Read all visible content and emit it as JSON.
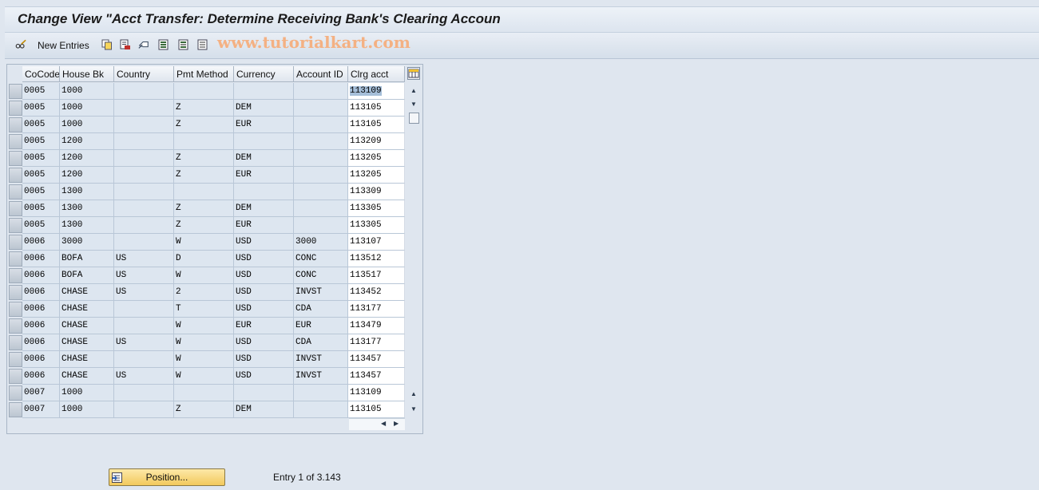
{
  "window": {
    "title": "Change View \"Acct Transfer: Determine Receiving Bank's Clearing Accoun"
  },
  "toolbar": {
    "new_entries_label": "New Entries",
    "icons": [
      "glasses-pencil-icon",
      "copy-icon",
      "delete-icon",
      "undo-icon",
      "select-all-icon",
      "select-block-icon",
      "deselect-all-icon"
    ],
    "watermark": "www.tutorialkart.com"
  },
  "table": {
    "columns": [
      "CoCode",
      "House Bk",
      "Country",
      "Pmt Method",
      "Currency",
      "Account ID",
      "Clrg acct"
    ],
    "rows": [
      [
        "0005",
        "1000",
        "",
        "",
        "",
        "",
        "113109"
      ],
      [
        "0005",
        "1000",
        "",
        "Z",
        "DEM",
        "",
        "113105"
      ],
      [
        "0005",
        "1000",
        "",
        "Z",
        "EUR",
        "",
        "113105"
      ],
      [
        "0005",
        "1200",
        "",
        "",
        "",
        "",
        "113209"
      ],
      [
        "0005",
        "1200",
        "",
        "Z",
        "DEM",
        "",
        "113205"
      ],
      [
        "0005",
        "1200",
        "",
        "Z",
        "EUR",
        "",
        "113205"
      ],
      [
        "0005",
        "1300",
        "",
        "",
        "",
        "",
        "113309"
      ],
      [
        "0005",
        "1300",
        "",
        "Z",
        "DEM",
        "",
        "113305"
      ],
      [
        "0005",
        "1300",
        "",
        "Z",
        "EUR",
        "",
        "113305"
      ],
      [
        "0006",
        "3000",
        "",
        "W",
        "USD",
        "3000",
        "113107"
      ],
      [
        "0006",
        "BOFA",
        "US",
        "D",
        "USD",
        "CONC",
        "113512"
      ],
      [
        "0006",
        "BOFA",
        "US",
        "W",
        "USD",
        "CONC",
        "113517"
      ],
      [
        "0006",
        "CHASE",
        "US",
        "2",
        "USD",
        "INVST",
        "113452"
      ],
      [
        "0006",
        "CHASE",
        "",
        "T",
        "USD",
        "CDA",
        "113177"
      ],
      [
        "0006",
        "CHASE",
        "",
        "W",
        "EUR",
        "EUR",
        "113479"
      ],
      [
        "0006",
        "CHASE",
        "US",
        "W",
        "USD",
        "CDA",
        "113177"
      ],
      [
        "0006",
        "CHASE",
        "",
        "W",
        "USD",
        "INVST",
        "113457"
      ],
      [
        "0006",
        "CHASE",
        "US",
        "W",
        "USD",
        "INVST",
        "113457"
      ],
      [
        "0007",
        "1000",
        "",
        "",
        "",
        "",
        "113109"
      ],
      [
        "0007",
        "1000",
        "",
        "Z",
        "DEM",
        "",
        "113105"
      ]
    ]
  },
  "footer": {
    "position_button_label": "Position...",
    "entry_info": "Entry 1 of 3.143"
  }
}
